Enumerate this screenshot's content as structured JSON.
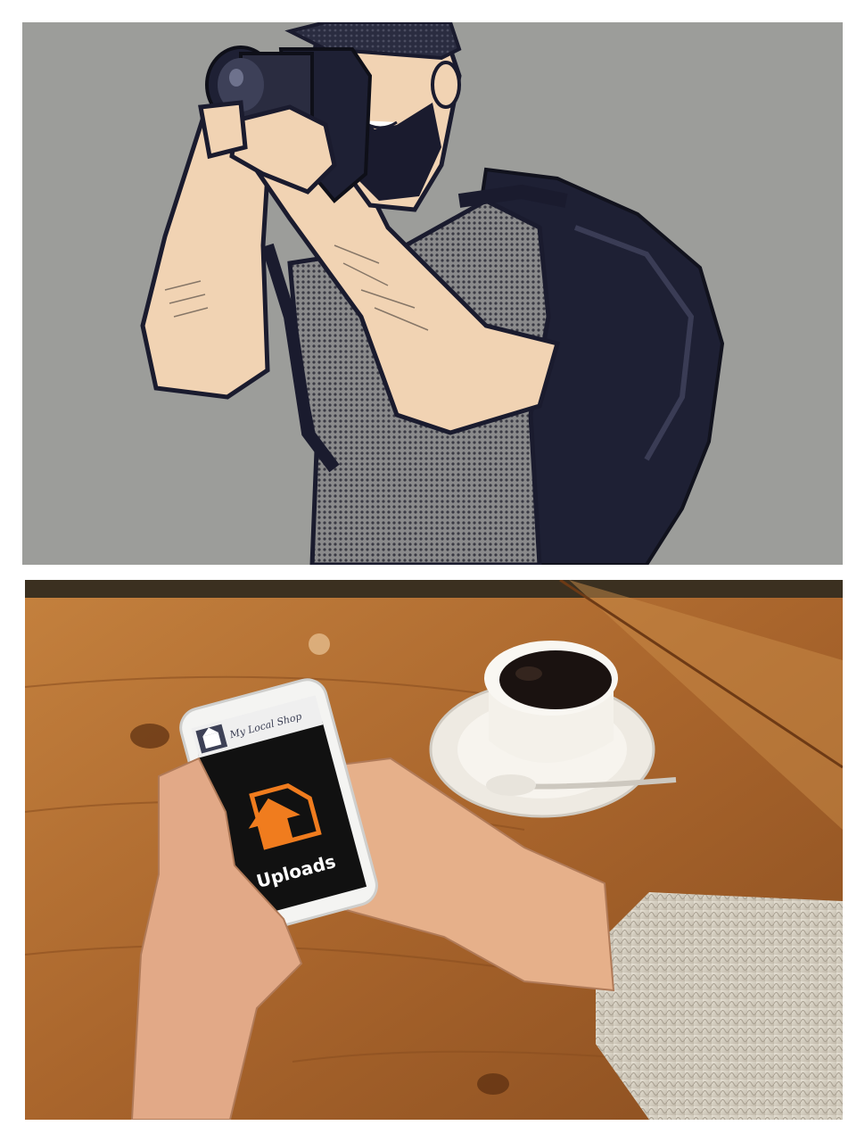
{
  "top_panel": {
    "subject": "photographer-illustration",
    "colors": {
      "background": "#9c9d9a",
      "skin": "#f1d3b3",
      "outline": "#1a1b2e",
      "shirt": "#6f6f70",
      "bag": "#1e2034"
    }
  },
  "bottom_panel": {
    "subject": "hands-holding-phone-on-wooden-table",
    "phone": {
      "header_title": "My Local Shop",
      "screen_label": "Uploads",
      "icons": [
        "shop-logo-icon",
        "upload-arrow-icon"
      ]
    },
    "colors": {
      "table": "#b6733a",
      "coffee": "#1a1210",
      "cup": "#f4f1ea",
      "sweater": "#d8d2c6",
      "accent": "#f07c1e"
    }
  }
}
